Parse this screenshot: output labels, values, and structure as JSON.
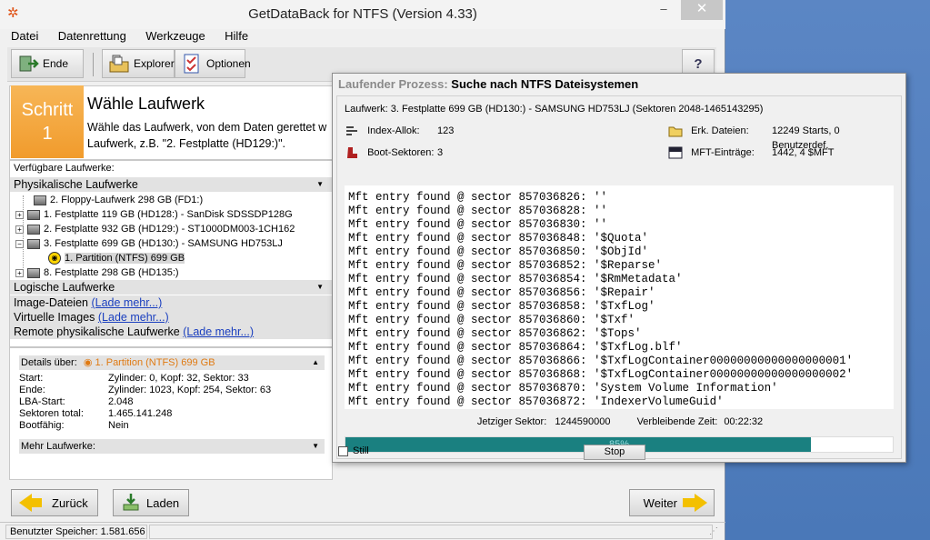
{
  "window": {
    "title": "GetDataBack for NTFS (Version 4.33)",
    "min": "–",
    "max": "□",
    "close": "✕"
  },
  "menu": {
    "datei": "Datei",
    "datenrettung": "Datenrettung",
    "werkzeuge": "Werkzeuge",
    "hilfe": "Hilfe"
  },
  "toolbar": {
    "ende": "Ende",
    "explorer": "Explorer",
    "optionen": "Optionen",
    "help": "?"
  },
  "step": {
    "label": "Schritt",
    "number": "1",
    "title": "Wähle Laufwerk",
    "desc_line1": "Wähle das Laufwerk, von dem Daten gerettet w",
    "desc_line2": "Laufwerk, z.B. \"2. Festplatte (HD129:)\"."
  },
  "drives": {
    "available_label": "Verfügbare Laufwerke:",
    "physical_header": "Physikalische Laufwerke",
    "items": [
      {
        "label": "2. Floppy-Laufwerk 298 GB (FD1:)"
      },
      {
        "label": "1. Festplatte 119 GB (HD128:) - SanDisk SDSSDP128G"
      },
      {
        "label": "2. Festplatte 932 GB (HD129:) - ST1000DM003-1CH162"
      },
      {
        "label": "3. Festplatte 699 GB (HD130:) - SAMSUNG HD753LJ"
      },
      {
        "label": "1. Partition (NTFS) 699 GB"
      },
      {
        "label": "8. Festplatte 298 GB (HD135:)"
      }
    ],
    "logical_header": "Logische Laufwerke",
    "image_files": "Image-Dateien",
    "virtual_images": "Virtuelle Images",
    "remote": "Remote physikalische Laufwerke",
    "load_more": "(Lade mehr...)",
    "load_more_remote": "(Lade mehr...)"
  },
  "details": {
    "header_label": "Details über:",
    "header_value": "1. Partition (NTFS) 699 GB",
    "rows": [
      {
        "k": "Start:",
        "v": "Zylinder: 0, Kopf: 32, Sektor: 33"
      },
      {
        "k": "Ende:",
        "v": "Zylinder: 1023, Kopf: 254, Sektor: 63"
      },
      {
        "k": "LBA-Start:",
        "v": "2.048"
      },
      {
        "k": "Sektoren total:",
        "v": "1.465.141.248"
      },
      {
        "k": "Bootfähig:",
        "v": "Nein"
      }
    ],
    "more": "Mehr Laufwerke:"
  },
  "nav": {
    "back": "Zurück",
    "load": "Laden",
    "next": "Weiter"
  },
  "status": {
    "memory": "Benutzter Speicher: 1.581.656",
    "second": ""
  },
  "process": {
    "title_label": "Laufender Prozess:",
    "title_value": "Suche nach NTFS Dateisystemen",
    "drive": "Laufwerk: 3. Festplatte 699 GB (HD130:) - SAMSUNG HD753LJ (Sektoren 2048-1465143295)",
    "index_label": "Index-Allok:",
    "index_value": "123",
    "boot_label": "Boot-Sektoren:",
    "boot_value": "3",
    "found_label": "Erk. Dateien:",
    "found_value": "12249 Starts, 0 Benutzerdef.",
    "mft_label": "MFT-Einträge:",
    "mft_value": "1442, 4 $MFT",
    "log_lines": [
      "Mft entry found @ sector 857036826: ''",
      "Mft entry found @ sector 857036828: ''",
      "Mft entry found @ sector 857036830: ''",
      "Mft entry found @ sector 857036848: '$Quota'",
      "Mft entry found @ sector 857036850: '$ObjId'",
      "Mft entry found @ sector 857036852: '$Reparse'",
      "Mft entry found @ sector 857036854: '$RmMetadata'",
      "Mft entry found @ sector 857036856: '$Repair'",
      "Mft entry found @ sector 857036858: '$TxfLog'",
      "Mft entry found @ sector 857036860: '$Txf'",
      "Mft entry found @ sector 857036862: '$Tops'",
      "Mft entry found @ sector 857036864: '$TxfLog.blf'",
      "Mft entry found @ sector 857036866: '$TxfLogContainer00000000000000000001'",
      "Mft entry found @ sector 857036868: '$TxfLogContainer00000000000000000002'",
      "Mft entry found @ sector 857036870: 'System Volume Information'",
      "Mft entry found @ sector 857036872: 'IndexerVolumeGuid'"
    ],
    "current_sector_label": "Jetziger Sektor:",
    "current_sector_value": "1244590000",
    "remaining_label": "Verbleibende Zeit:",
    "remaining_value": "00:22:32",
    "progress_text": "85%",
    "progress_fraction": 0.85,
    "still_label": "Still",
    "stop_label": "Stop"
  },
  "colors": {
    "step_orange": "#f19b2c",
    "progress_teal": "#1a8080",
    "link_blue": "#1a3fbf"
  }
}
